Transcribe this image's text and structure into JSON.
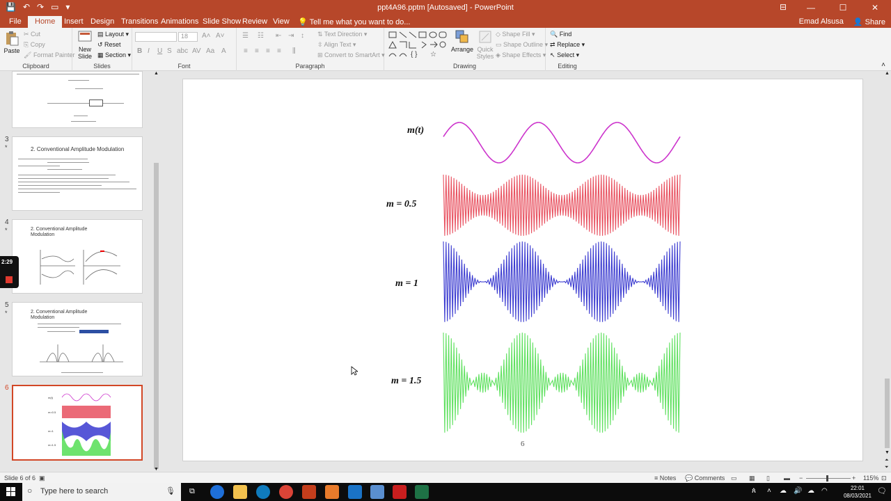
{
  "titlebar": {
    "doc_title": "ppt4A96.pptm [Autosaved] - PowerPoint",
    "win_min": "—",
    "win_max": "☐",
    "win_close": "✕",
    "ribbon_display": "⊟"
  },
  "tabs": [
    {
      "label": "File"
    },
    {
      "label": "Home"
    },
    {
      "label": "Insert"
    },
    {
      "label": "Design"
    },
    {
      "label": "Transitions"
    },
    {
      "label": "Animations"
    },
    {
      "label": "Slide Show"
    },
    {
      "label": "Review"
    },
    {
      "label": "View"
    }
  ],
  "tell_me": "Tell me what you want to do...",
  "user": "Emad Alsusa",
  "share": "Share",
  "ribbon": {
    "clipboard": {
      "label": "Clipboard",
      "paste": "Paste",
      "cut": "Cut",
      "copy": "Copy",
      "format_painter": "Format Painter"
    },
    "slides": {
      "label": "Slides",
      "new_slide_1": "New",
      "new_slide_2": "Slide",
      "layout": "Layout",
      "reset": "Reset",
      "section": "Section"
    },
    "font": {
      "label": "Font",
      "size": "18"
    },
    "paragraph": {
      "label": "Paragraph",
      "text_direction": "Text Direction",
      "align_text": "Align Text",
      "convert_smartart": "Convert to SmartArt"
    },
    "drawing": {
      "label": "Drawing",
      "arrange": "Arrange",
      "quick_styles_1": "Quick",
      "quick_styles_2": "Styles",
      "shape_fill": "Shape Fill",
      "shape_outline": "Shape Outline",
      "shape_effects": "Shape Effects"
    },
    "editing": {
      "label": "Editing",
      "find": "Find",
      "replace": "Replace",
      "select": "Select"
    }
  },
  "thumbnails": [
    {
      "number": "3",
      "title": "2. Conventional Amplitude Modulation"
    },
    {
      "number": "4",
      "title": "2. Conventional Amplitude Modulation"
    },
    {
      "number": "5",
      "title": "2. Conventional Amplitude Modulation"
    },
    {
      "number": "6",
      "title": ""
    }
  ],
  "recorder": {
    "time": "2:29"
  },
  "slide": {
    "labels": [
      "m(t)",
      "m = 0.5",
      "m = 1",
      "m = 1.5"
    ],
    "page_number": "6",
    "colors": {
      "message": "#cc33cc",
      "m05": "#e8505f",
      "m1": "#3a3ad0",
      "m15": "#5ee05e"
    }
  },
  "statusbar": {
    "slide_info": "Slide 6 of 6",
    "notes": "Notes",
    "comments": "Comments",
    "zoom": "115%"
  },
  "taskbar": {
    "search_placeholder": "Type here to search",
    "time": "22:01",
    "date": "08/03/2021"
  }
}
